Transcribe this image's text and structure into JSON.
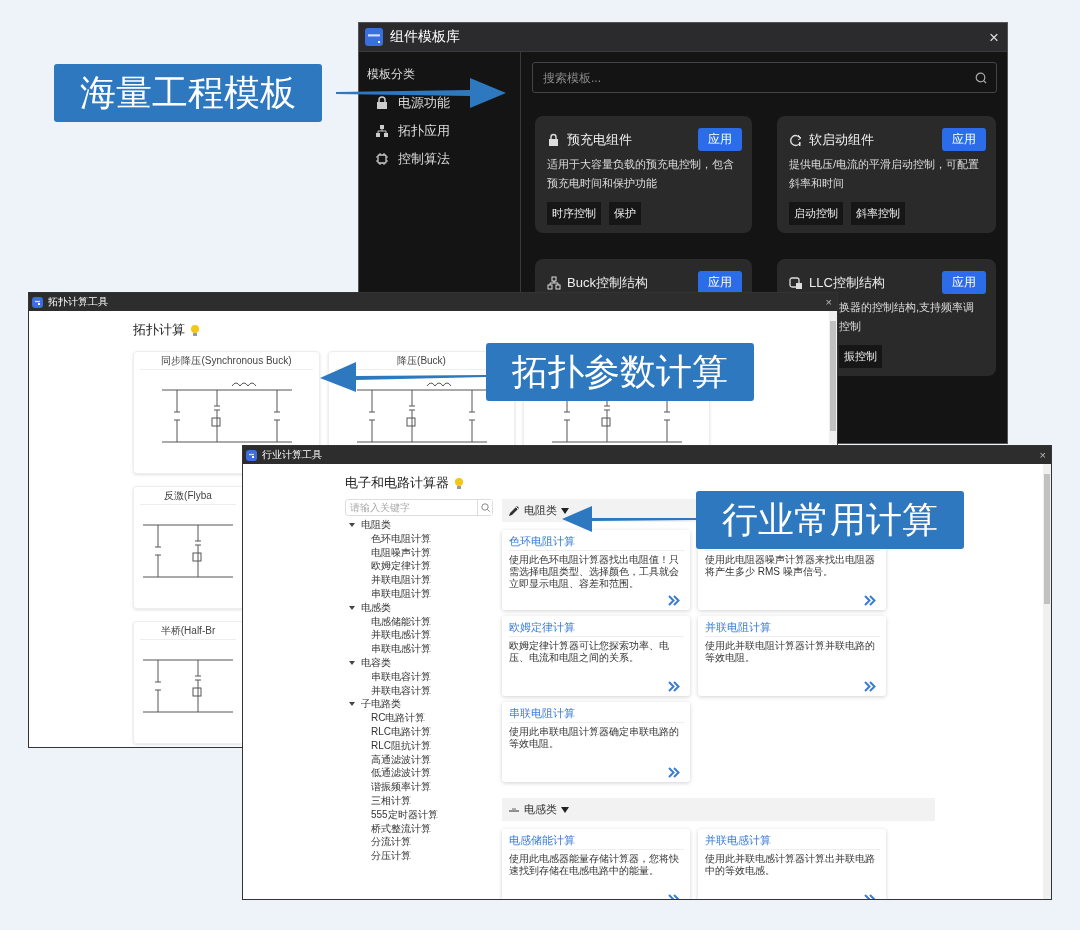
{
  "template_window": {
    "title": "组件模板库",
    "close": "×",
    "sidebar": {
      "heading": "模板分类",
      "items": [
        {
          "label": "电源功能"
        },
        {
          "label": "拓扑应用"
        },
        {
          "label": "控制算法"
        }
      ]
    },
    "search": {
      "placeholder": "搜索模板..."
    },
    "cards": [
      {
        "title": "预充电组件",
        "button": "应用",
        "description": [
          "适用于大容量负载的预充电控制，包含",
          "预充电时间和保护功能"
        ],
        "tags": [
          "时序控制",
          "保护"
        ]
      },
      {
        "title": "软启动组件",
        "button": "应用",
        "description": [
          "提供电压/电流的平滑启动控制，可配置",
          "斜率和时间"
        ],
        "tags": [
          "启动控制",
          "斜率控制"
        ]
      },
      {
        "title": "Buck控制结构",
        "button": "应用"
      },
      {
        "title": "LLC控制结构",
        "button": "应用",
        "description": [
          "换器的控制结构,支持频率调",
          "控制"
        ],
        "tags": [
          "振控制"
        ]
      }
    ]
  },
  "topology_window": {
    "title": "拓扑计算工具",
    "close": "×",
    "heading": "拓扑计算",
    "cards": [
      {
        "title": "同步降压(Synchronous Buck)",
        "diagram": true
      },
      {
        "title": "降压(Buck)",
        "diagram": true
      },
      {
        "diagram": true
      },
      {
        "title": "反激(Flyba",
        "diagram": true
      },
      {
        "title": "半桥(Half-Br",
        "diagram": true
      }
    ]
  },
  "industry_window": {
    "title": "行业计算工具",
    "close": "×",
    "heading": "电子和电路计算器",
    "search": {
      "placeholder": "请输入关键字"
    },
    "tree": [
      {
        "label": "电阻类",
        "expanded": true,
        "children": [
          {
            "label": "色环电阻计算"
          },
          {
            "label": "电阻噪声计算"
          },
          {
            "label": "欧姆定律计算"
          },
          {
            "label": "并联电阻计算"
          },
          {
            "label": "串联电阻计算"
          }
        ]
      },
      {
        "label": "电感类",
        "expanded": true,
        "children": [
          {
            "label": "电感储能计算"
          },
          {
            "label": "并联电感计算"
          },
          {
            "label": "串联电感计算"
          }
        ]
      },
      {
        "label": "电容类",
        "expanded": true,
        "children": [
          {
            "label": "串联电容计算"
          },
          {
            "label": "并联电容计算"
          }
        ]
      },
      {
        "label": "子电路类",
        "expanded": true,
        "children": [
          {
            "label": "RC电路计算"
          },
          {
            "label": "RLC电路计算"
          },
          {
            "label": "RLC阻抗计算"
          },
          {
            "label": "高通滤波计算"
          },
          {
            "label": "低通滤波计算"
          },
          {
            "label": "谐振频率计算"
          },
          {
            "label": "三相计算"
          },
          {
            "label": "555定时器计算"
          },
          {
            "label": "桥式整流计算"
          },
          {
            "label": "分流计算"
          },
          {
            "label": "分压计算"
          }
        ]
      }
    ],
    "sections": [
      {
        "title": "电阻类",
        "expanded": true,
        "cards": [
          {
            "title": "色环电阻计算",
            "description": "使用此色环电阻计算器找出电阻值！只需选择电阻类型、选择颜色，工具就会立即显示电阻、容差和范围。"
          },
          {
            "description": "使用此电阻器噪声计算器来找出电阻器将产生多少 RMS 噪声信号。"
          },
          {
            "title": "欧姆定律计算",
            "description": "欧姆定律计算器可让您探索功率、电压、电流和电阻之间的关系。"
          },
          {
            "title": "并联电阻计算",
            "description": "使用此并联电阻计算器计算并联电路的等效电阻。"
          },
          {
            "title": "串联电阻计算",
            "description": "使用此串联电阻计算器确定串联电路的等效电阻。"
          }
        ]
      },
      {
        "title": "电感类",
        "expanded": true,
        "cards": [
          {
            "title": "电感储能计算",
            "description": "使用此电感器能量存储计算器，您将快速找到存储在电感电路中的能量。"
          },
          {
            "title": "并联电感计算",
            "description": "使用此并联电感计算器计算出并联电路中的等效电感。"
          }
        ]
      }
    ]
  },
  "callouts": [
    {
      "text": "海量工程模板"
    },
    {
      "text": "拓扑参数计算"
    },
    {
      "text": "行业常用计算"
    }
  ]
}
